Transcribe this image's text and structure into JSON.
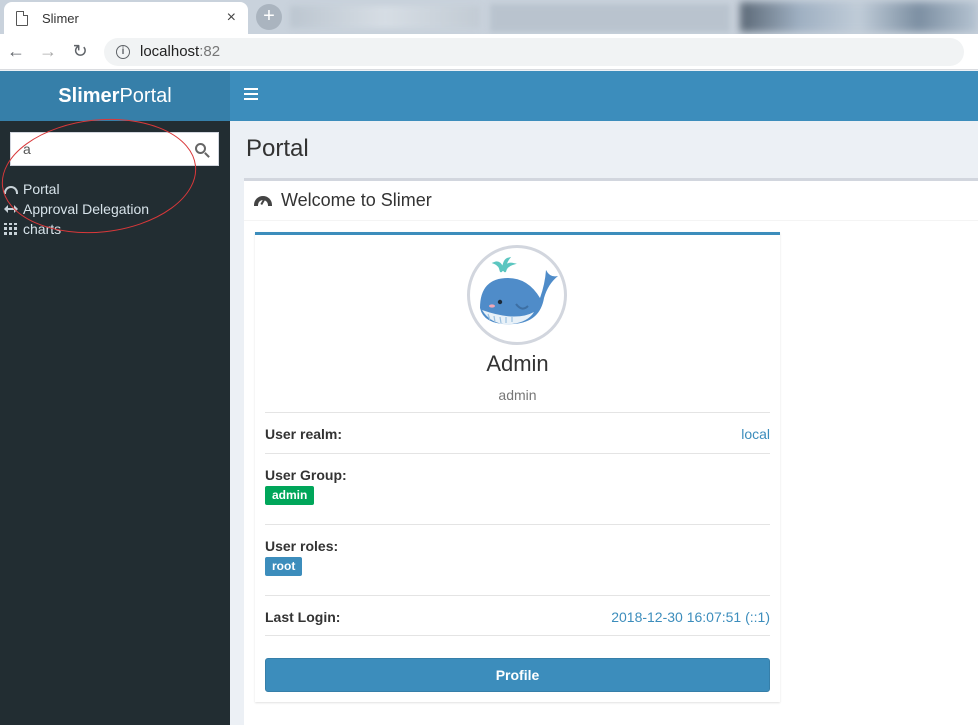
{
  "browser": {
    "tab_title": "Slimer",
    "tab_close": "×",
    "new_tab": "+",
    "url_host": "localhost",
    "url_port": ":82",
    "back": "←",
    "forward": "→",
    "reload": "↻",
    "info": "i"
  },
  "app": {
    "logo_bold": "Slimer",
    "logo_light": "Portal",
    "page_title": "Portal"
  },
  "sidebar": {
    "search_value": "a",
    "items": [
      {
        "label": "Portal",
        "icon": "dashboard-icon"
      },
      {
        "label": "Approval Delegation",
        "icon": "arrows-h-icon"
      },
      {
        "label": "charts",
        "icon": "grid-icon"
      }
    ]
  },
  "panel": {
    "title": "Welcome to Slimer"
  },
  "profile": {
    "name": "Admin",
    "username": "admin",
    "realm_label": "User realm:",
    "realm_value": "local",
    "group_label": "User Group:",
    "group_badge": "admin",
    "roles_label": "User roles:",
    "roles_badge": "root",
    "last_login_label": "Last Login:",
    "last_login_value": "2018-12-30 16:07:51 (::1)",
    "button_label": "Profile"
  },
  "colors": {
    "header": "#3c8dbc",
    "logo": "#367fa9",
    "sidebar": "#222d32",
    "success": "#00a65a",
    "annotation": "#d9383a"
  }
}
